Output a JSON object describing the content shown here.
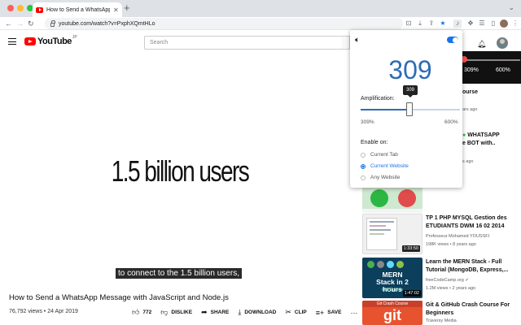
{
  "browser": {
    "tab_title": "How to Send a WhatsApp Message",
    "url": "youtube.com/watch?v=PxphXQmtHLo"
  },
  "youtube": {
    "logo_text": "YouTube",
    "region": "JP",
    "search_placeholder": "Search"
  },
  "player": {
    "slide_text": "1.5 billion users",
    "caption": "to connect to the 1.5 billion users,"
  },
  "video": {
    "title": "How to Send a WhatsApp Message with JavaScript and Node.js",
    "meta": "76,792 views • 24 Apr 2019",
    "actions": [
      {
        "icon": "thumbs-up-icon",
        "label": "772"
      },
      {
        "icon": "thumbs-down-icon",
        "label": "DISLIKE"
      },
      {
        "icon": "share-icon",
        "label": "SHARE"
      },
      {
        "icon": "download-icon",
        "label": "DOWNLOAD"
      },
      {
        "icon": "clip-icon",
        "label": "CLIP"
      },
      {
        "icon": "save-icon",
        "label": "SAVE"
      }
    ]
  },
  "extension": {
    "value": "309",
    "amplification_label": "Amplification:",
    "tooltip": "309",
    "slider_fraction": 0.21,
    "range_min": "309%",
    "range_max": "600%",
    "enable_label": "Enable on:",
    "options": [
      {
        "label": "Current Tab",
        "selected": false
      },
      {
        "label": "Current Website",
        "selected": true
      },
      {
        "label": "Any Website",
        "selected": false
      }
    ],
    "accent_color": "#2d6db4"
  },
  "sidebar_strip": {
    "left": "309%",
    "right": "600%"
  },
  "sidebar_partials": {
    "p1": "ourse",
    "p2": "ars ago",
    "p3": "WHATSAPP",
    "p4": "e BOT with..",
    "p5": "s ago"
  },
  "sidebar": [
    {
      "title": "TP 1 PHP MYSQL Gestion des ETUDIANTS DWM 16 02 2014",
      "channel": "Professeur Mohamed YOUSSFI",
      "views": "198K views • 8 years ago",
      "duration": "1:33:50"
    },
    {
      "title": "Learn the MERN Stack - Full Tutorial (MongoDB, Express,...",
      "channel": "freeCodeCamp.org",
      "views": "1.2M views • 2 years ago",
      "duration": "1:47:02",
      "thumb_title": "MERN Stack in 2 hours",
      "thumb_sub": "Full Course"
    },
    {
      "title": "Git & GitHub Crash Course For Beginners",
      "channel": "Traversy Media",
      "views": "",
      "duration": "",
      "thumb_title": "git",
      "thumb_sub": "Git Crash Course"
    }
  ]
}
